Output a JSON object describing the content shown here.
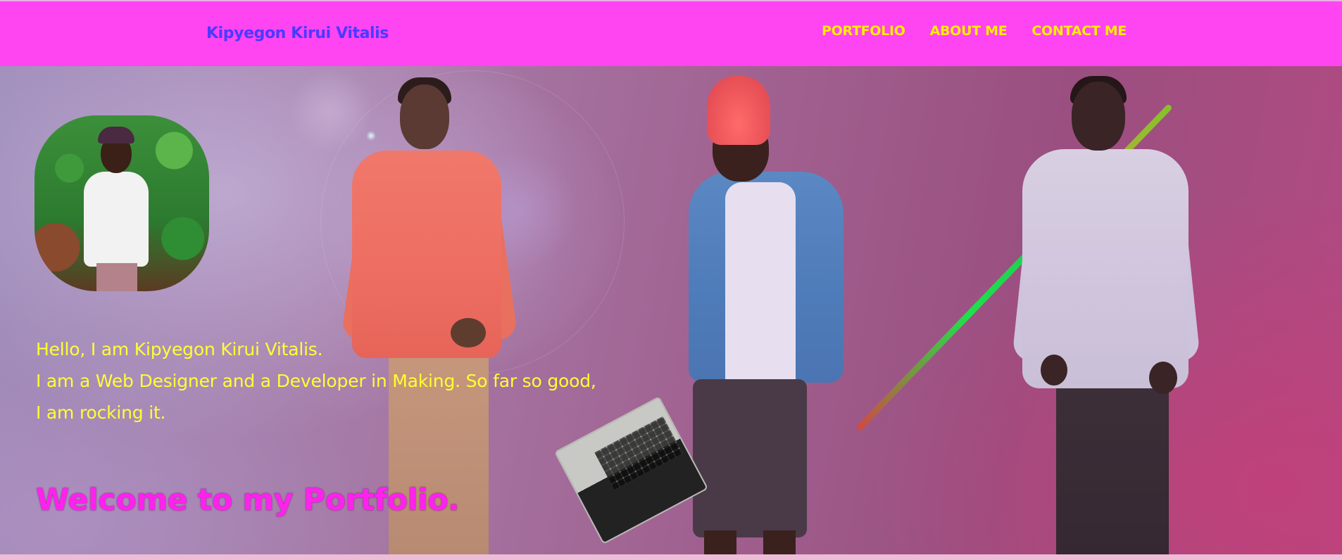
{
  "header": {
    "brand": "Kipyegon Kirui Vitalis",
    "nav": [
      "PORTFOLIO",
      "ABOUT ME",
      "CONTACT ME"
    ]
  },
  "hero": {
    "intro_lines": [
      "Hello, I am Kipyegon Kirui Vitalis.",
      "I am a Web Designer and a Developer in Making. So far so good,",
      "I am rocking it."
    ],
    "welcome": "Welcome to my Portfolio."
  },
  "colors": {
    "header_bg": "#ff44f2",
    "brand": "#4a3aff",
    "nav": "#ffee00",
    "intro": "#ffff33",
    "welcome": "#ff22ee"
  }
}
